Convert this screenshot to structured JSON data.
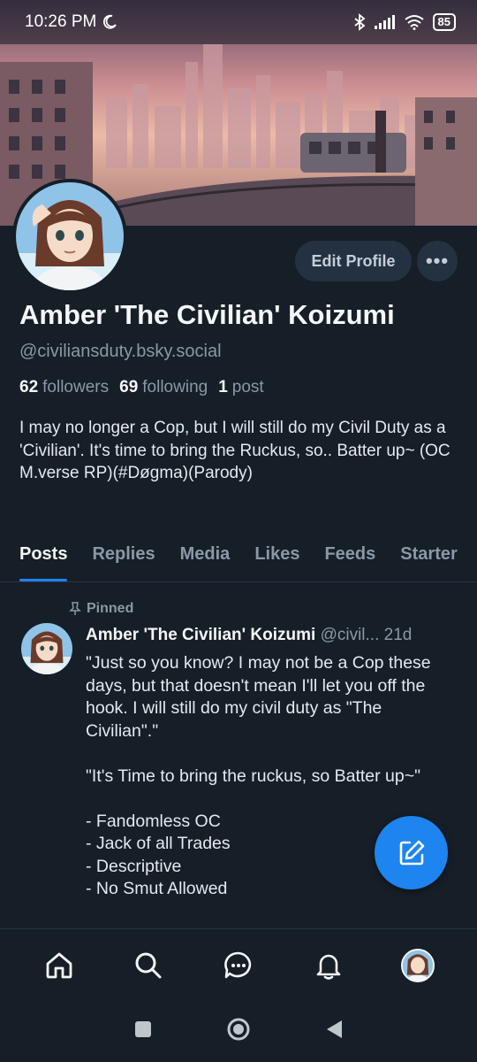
{
  "status_bar": {
    "time": "10:26 PM",
    "battery": "85"
  },
  "profile": {
    "display_name": "Amber 'The Civilian' Koizumi",
    "handle": "@civiliansduty.bsky.social",
    "edit_label": "Edit Profile",
    "more_label": "•••",
    "stats": {
      "followers_count": "62",
      "followers_label": "followers",
      "following_count": "69",
      "following_label": "following",
      "posts_count": "1",
      "posts_label": "post"
    },
    "bio": "I may no longer a Cop, but I will still do my Civil Duty as a 'Civilian'. It's time to bring the Ruckus, so.. Batter up~ (OC M.verse RP)(#Døgma)(Parody)"
  },
  "tabs": [
    {
      "label": "Posts"
    },
    {
      "label": "Replies"
    },
    {
      "label": "Media"
    },
    {
      "label": "Likes"
    },
    {
      "label": "Feeds"
    },
    {
      "label": "Starter"
    }
  ],
  "pinned_post": {
    "pinned_label": "Pinned",
    "author_name": "Amber 'The Civilian' Koizumi",
    "author_handle": "@civil...",
    "age": "21d",
    "paragraph_1": "\"Just so you know? I may not be a Cop these days, but that doesn't mean I'll let you off the hook. I will still do my civil duty as \"The Civilian\".\"",
    "paragraph_2": "\"It's Time to bring the ruckus, so Batter up~\"",
    "list": [
      "- Fandomless OC",
      "- Jack of all Trades",
      "- Descriptive",
      "- No Smut Allowed"
    ]
  },
  "icons": {
    "fab": "compose-icon",
    "nav": [
      "home-icon",
      "search-icon",
      "chat-icon",
      "bell-icon",
      "profile-avatar"
    ],
    "system": [
      "recents-icon",
      "home-circle-icon",
      "back-icon"
    ]
  },
  "colors": {
    "background": "#161e27",
    "accent": "#1d84f0",
    "muted_text": "#8b98a6"
  }
}
